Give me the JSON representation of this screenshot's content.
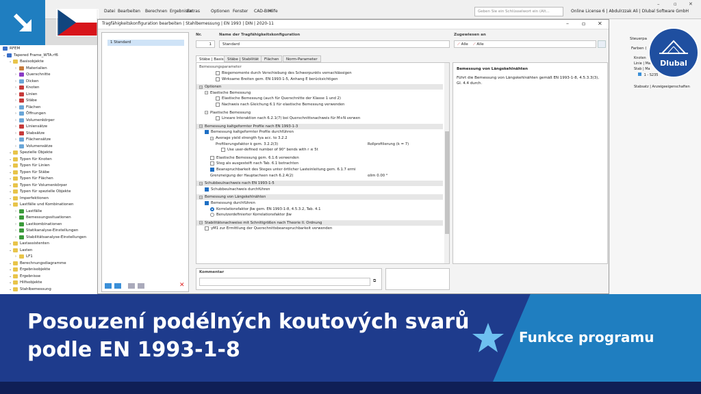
{
  "menu": {
    "items": [
      "Datei",
      "Bearbeiten",
      "Berechnen",
      "Ergebnisse",
      "Extras",
      "Optionen",
      "Fenster",
      "CAD-BIM",
      "Hilfe"
    ]
  },
  "search": {
    "placeholder": "Geben Sie ein Schlüsselwort ein (Alt..."
  },
  "license": "Online License 6 | Abdulrzzak Ali | Dlubal Software GmbH",
  "navigator": {
    "title": "RFEM",
    "items": [
      {
        "label": "Tapered Frame_WTA.rf6",
        "indent": 0,
        "color": "#3a6fc8"
      },
      {
        "label": "Basisobjekte",
        "indent": 1,
        "color": "#e8c44a"
      },
      {
        "label": "Materialien",
        "indent": 2,
        "color": "#c67a3a"
      },
      {
        "label": "Querschnitte",
        "indent": 2,
        "color": "#8a3ac6"
      },
      {
        "label": "Dicken",
        "indent": 2,
        "color": "#6aa6d8"
      },
      {
        "label": "Knoten",
        "indent": 2,
        "color": "#c63a3a"
      },
      {
        "label": "Linien",
        "indent": 2,
        "color": "#c63a3a"
      },
      {
        "label": "Stäbe",
        "indent": 2,
        "color": "#c63a3a"
      },
      {
        "label": "Flächen",
        "indent": 2,
        "color": "#6aa6d8"
      },
      {
        "label": "Öffnungen",
        "indent": 2,
        "color": "#6aa6d8"
      },
      {
        "label": "Volumenkörper",
        "indent": 2,
        "color": "#6aa6d8"
      },
      {
        "label": "Liniensätze",
        "indent": 2,
        "color": "#c63a3a"
      },
      {
        "label": "Stabsätze",
        "indent": 2,
        "color": "#c63a3a"
      },
      {
        "label": "Flächensätze",
        "indent": 2,
        "color": "#6aa6d8"
      },
      {
        "label": "Volumensätze",
        "indent": 2,
        "color": "#6aa6d8"
      },
      {
        "label": "Spezielle Objekte",
        "indent": 1,
        "color": "#e8c44a"
      },
      {
        "label": "Typen für Knoten",
        "indent": 1,
        "color": "#e8c44a"
      },
      {
        "label": "Typen für Linien",
        "indent": 1,
        "color": "#e8c44a"
      },
      {
        "label": "Typen für Stäbe",
        "indent": 1,
        "color": "#e8c44a"
      },
      {
        "label": "Typen für Flächen",
        "indent": 1,
        "color": "#e8c44a"
      },
      {
        "label": "Typen für Volumenkörper",
        "indent": 1,
        "color": "#e8c44a"
      },
      {
        "label": "Typen für spezielle Objekte",
        "indent": 1,
        "color": "#e8c44a"
      },
      {
        "label": "Imperfektionen",
        "indent": 1,
        "color": "#e8c44a"
      },
      {
        "label": "Lastfälle und Kombinationen",
        "indent": 1,
        "color": "#e8c44a"
      },
      {
        "label": "Lastfälle",
        "indent": 2,
        "color": "#3a9a3a"
      },
      {
        "label": "Bemessungssituationen",
        "indent": 2,
        "color": "#3a9a3a"
      },
      {
        "label": "Lastkombinationen",
        "indent": 2,
        "color": "#3a9a3a"
      },
      {
        "label": "Statikanalyse-Einstellungen",
        "indent": 2,
        "color": "#3a9a3a"
      },
      {
        "label": "Stabilitätsanalyse-Einstellungen",
        "indent": 2,
        "color": "#3a9a3a"
      },
      {
        "label": "Lastassistenten",
        "indent": 1,
        "color": "#e8c44a"
      },
      {
        "label": "Lasten",
        "indent": 1,
        "color": "#e8c44a"
      },
      {
        "label": "LF1",
        "indent": 2,
        "color": "#e8c44a"
      },
      {
        "label": "Berechnungsdiagramme",
        "indent": 1,
        "color": "#e8c44a"
      },
      {
        "label": "Ergebnisobjekte",
        "indent": 1,
        "color": "#e8c44a"
      },
      {
        "label": "Ergebnisse",
        "indent": 1,
        "color": "#e8c44a"
      },
      {
        "label": "Hilfsobjekte",
        "indent": 1,
        "color": "#e8c44a"
      },
      {
        "label": "Stahlbemessung",
        "indent": 1,
        "color": "#e8c44a"
      }
    ]
  },
  "dialog": {
    "title": "Tragfähigkeitskonfiguration bearbeiten | Stahlbemessung | EN 1993 | DIN | 2020-11",
    "list_item": "1  Standard",
    "no_label": "Nr.",
    "no_value": "1",
    "name_label": "Name der Tragfähigkeitskonfiguration",
    "name_value": "Standard",
    "assigned_label": "Zugewiesen an",
    "assigned_all1": "Alle",
    "assigned_all2": "Alle",
    "tabs": [
      "Stäbe | Basis",
      "Stäbe | Stabilität",
      "Flächen",
      "Norm-Parameter"
    ],
    "params_header": "Bemessungsparameter",
    "rows": [
      {
        "t": "Biegemomente durch Verschiebung des Schwerpunkts vernachlässigen",
        "lvl": 3,
        "k": "cb",
        "on": false
      },
      {
        "t": "Wirksame Breiten gem. EN 1993-1-5, Anhang E berücksichtigen",
        "lvl": 3,
        "k": "cb",
        "on": false
      },
      {
        "t": "",
        "lvl": 0,
        "k": "gap"
      },
      {
        "t": "Optionen",
        "lvl": 0,
        "k": "group"
      },
      {
        "t": "Elastische Bemessung",
        "lvl": 1,
        "k": "exp"
      },
      {
        "t": "Elastische Bemessung (auch für Querschnitte der Klasse 1 und 2)",
        "lvl": 3,
        "k": "cb",
        "on": false
      },
      {
        "t": "Nachweis nach Gleichung 6.1 für elastische Bemessung verwenden",
        "lvl": 3,
        "k": "cb",
        "on": false
      },
      {
        "t": "",
        "lvl": 0,
        "k": "gap"
      },
      {
        "t": "Plastische Bemessung",
        "lvl": 1,
        "k": "exp"
      },
      {
        "t": "Lineare Interaktion nach 6.2.1(7) bei Querschnittsnachweis für M+N verwen",
        "lvl": 3,
        "k": "cb",
        "on": false
      },
      {
        "t": "",
        "lvl": 0,
        "k": "gap"
      },
      {
        "t": "Bemessung kaltgeformter Profile nach EN 1993-1-3",
        "lvl": 0,
        "k": "group"
      },
      {
        "t": "Bemessung kaltgeformter Profile durchführen",
        "lvl": 1,
        "k": "cb",
        "on": true
      },
      {
        "t": "Average yield strength fya acc. to 3.2.2",
        "lvl": 2,
        "k": "exp"
      },
      {
        "t": "Profilierungsfaktor k gem. 3.2.2(3)",
        "lvl": 3,
        "k": "txt",
        "val": "Rollprofilierung (k = 7)"
      },
      {
        "t": "Use user-defined number of 90° bends with r ≤ 5t",
        "lvl": 4,
        "k": "cb",
        "on": false
      },
      {
        "t": "",
        "lvl": 0,
        "k": "gap"
      },
      {
        "t": "Elastische Bemessung gem. 6.1.6 verwenden",
        "lvl": 2,
        "k": "cb",
        "on": false
      },
      {
        "t": "Steg als ausgesteift nach Tab. 6.1 betrachten",
        "lvl": 2,
        "k": "cb",
        "on": false
      },
      {
        "t": "Beanspruchbarkeit des Steges unter örtlicher Lasteinleitung gem. 6.1.7 ermi",
        "lvl": 2,
        "k": "cb",
        "on": true
      },
      {
        "t": "Grenzneigung der Hauptachsen nach 6.2.4(2)",
        "lvl": 2,
        "k": "txt",
        "val": "αlim    0.00  °"
      },
      {
        "t": "",
        "lvl": 0,
        "k": "gap"
      },
      {
        "t": "Schubbeulnachweis nach EN 1993-1-5",
        "lvl": 0,
        "k": "group"
      },
      {
        "t": "Schubbeulnachweis durchführen",
        "lvl": 1,
        "k": "cb",
        "on": true
      },
      {
        "t": "",
        "lvl": 0,
        "k": "gap"
      },
      {
        "t": "Bemessung von Längskehlnähten",
        "lvl": 0,
        "k": "group"
      },
      {
        "t": "Bemessung durchführen",
        "lvl": 1,
        "k": "cb",
        "on": true
      },
      {
        "t": "Korrelationsfaktor βw gem. EN 1993-1-8, 4.5.3.2, Tab. 4.1",
        "lvl": 2,
        "k": "radio",
        "on": true
      },
      {
        "t": "Benutzerdefinierter Korrelationsfaktor βw",
        "lvl": 2,
        "k": "radio",
        "on": false
      },
      {
        "t": "",
        "lvl": 0,
        "k": "gap"
      },
      {
        "t": "Stabilitätsnachweise mit Schnittgrößen nach Theorie II. Ordnung",
        "lvl": 0,
        "k": "group"
      },
      {
        "t": "γM1 zur Ermittlung der Querschnittsbeanspruchbarkeit verwenden",
        "lvl": 1,
        "k": "cb",
        "on": false
      }
    ],
    "desc_title": "Bemessung von Längskehlnähten",
    "desc_text": "Führt die Bemessung von Längskehlnähten gemäß EN 1993-1-8, 4.5.3.3(3), Gl. 4.4 durch.",
    "comment_label": "Kommentar"
  },
  "rightpane": {
    "title": "Steuerpa",
    "line1": "Farben (",
    "line2": "Knoten",
    "line3": "Linie | Ma",
    "line4": "Stab | Ma",
    "line5": "1 - S235",
    "line6": "Stabsatz | Anzeigeeigenschaften"
  },
  "banner": {
    "title": "Posouzení podélných koutových svarů podle EN 1993-1-8",
    "feature": "Funkce programu",
    "logo": "Dlubal"
  },
  "colors": {
    "accent": "#1e3b8c",
    "light_blue": "#1f7ec0",
    "checkbox_on": "#1e6fc4"
  }
}
